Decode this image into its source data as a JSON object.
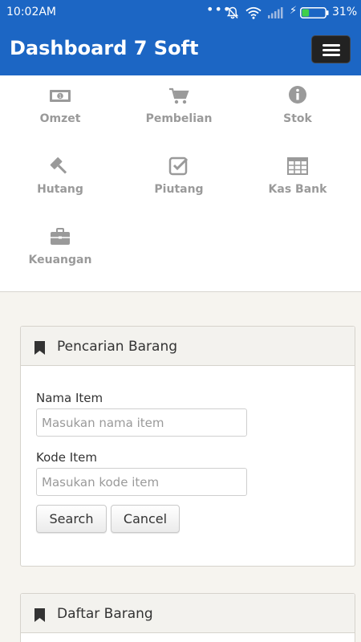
{
  "status_bar": {
    "time": "10:02AM",
    "dots": "•••",
    "battery_percent": "31%",
    "battery_level": 0.31,
    "icons": [
      "mute-bell-icon",
      "wifi-icon",
      "signal-icon",
      "charging-bolt-icon",
      "battery-icon"
    ]
  },
  "app": {
    "title": "Dashboard 7 Soft",
    "menu_icon": "hamburger-menu-icon"
  },
  "menu": [
    {
      "label": "Omzet",
      "icon": "money-bill-icon"
    },
    {
      "label": "Pembelian",
      "icon": "shopping-cart-icon"
    },
    {
      "label": "Stok",
      "icon": "info-circle-icon"
    },
    {
      "label": "Hutang",
      "icon": "gavel-icon"
    },
    {
      "label": "Piutang",
      "icon": "check-square-icon"
    },
    {
      "label": "Kas Bank",
      "icon": "table-grid-icon"
    },
    {
      "label": "Keuangan",
      "icon": "briefcase-icon"
    }
  ],
  "search_panel": {
    "title": "Pencarian Barang",
    "icon": "bookmark-icon",
    "nama_label": "Nama Item",
    "nama_placeholder": "Masukan nama item",
    "kode_label": "Kode Item",
    "kode_placeholder": "Masukan kode item",
    "search_label": "Search",
    "cancel_label": "Cancel"
  },
  "list_panel": {
    "title": "Daftar Barang",
    "icon": "bookmark-icon"
  },
  "colors": {
    "primary": "#1c66c4",
    "menu_icon_gray": "#9a9a9a",
    "page_bg": "#f6f4ef"
  }
}
